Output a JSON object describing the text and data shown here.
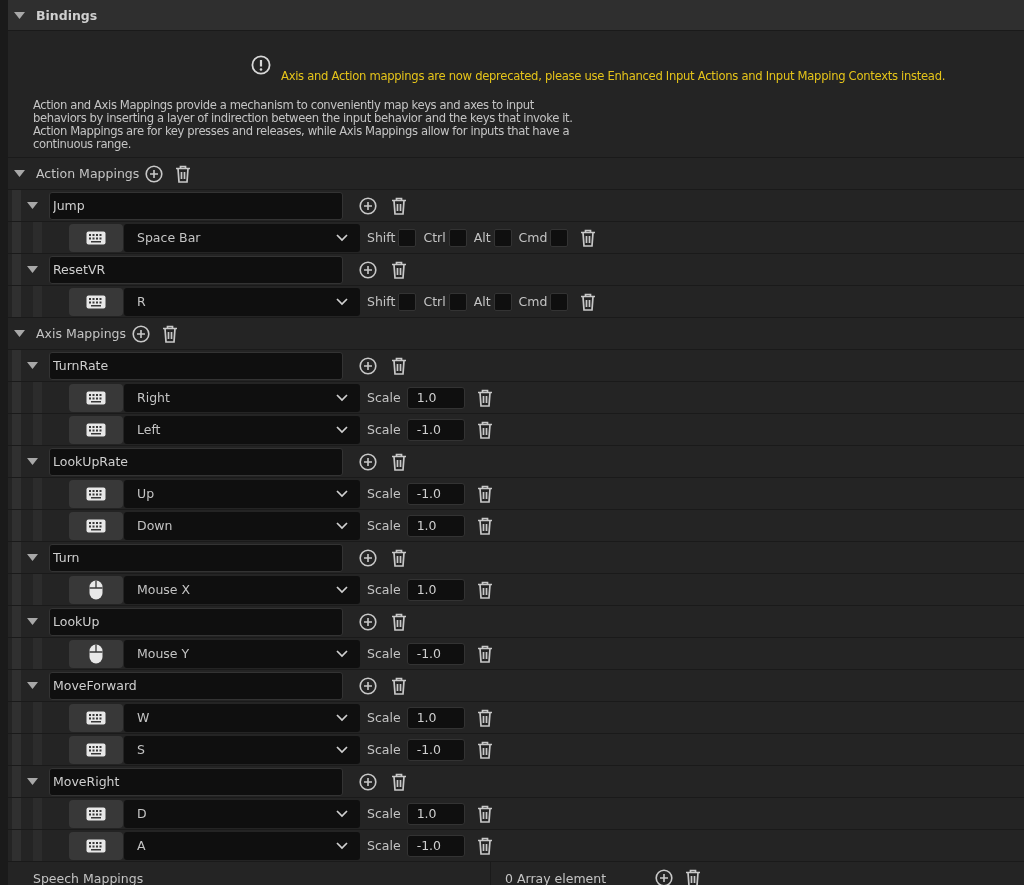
{
  "section": {
    "title": "Bindings",
    "expanded": true
  },
  "warning": "Axis and Action mappings are now deprecated, please use Enhanced Input Actions and Input Mapping Contexts instead.",
  "description": "Action and Axis Mappings provide a mechanism to conveniently map keys and axes to input behaviors by inserting a layer of indirection between the input behavior and the keys that invoke it. Action Mappings are for key presses and releases, while Axis Mappings allow for inputs that have a continuous range.",
  "action_mappings": {
    "label": "Action Mappings",
    "expanded": true,
    "items": [
      {
        "name": "Jump",
        "expanded": true,
        "keys": [
          {
            "kind": "keyboard",
            "key": "Space Bar",
            "modifiers": [
              {
                "label": "Shift",
                "checked": false
              },
              {
                "label": "Ctrl",
                "checked": false
              },
              {
                "label": "Alt",
                "checked": false
              },
              {
                "label": "Cmd",
                "checked": false
              }
            ]
          }
        ]
      },
      {
        "name": "ResetVR",
        "expanded": true,
        "keys": [
          {
            "kind": "keyboard",
            "key": "R",
            "modifiers": [
              {
                "label": "Shift",
                "checked": false
              },
              {
                "label": "Ctrl",
                "checked": false
              },
              {
                "label": "Alt",
                "checked": false
              },
              {
                "label": "Cmd",
                "checked": false
              }
            ]
          }
        ]
      }
    ]
  },
  "axis_mappings": {
    "label": "Axis Mappings",
    "expanded": true,
    "items": [
      {
        "name": "TurnRate",
        "expanded": true,
        "keys": [
          {
            "kind": "keyboard",
            "key": "Right",
            "scale_label": "Scale",
            "scale": "1.0"
          },
          {
            "kind": "keyboard",
            "key": "Left",
            "scale_label": "Scale",
            "scale": "-1.0"
          }
        ]
      },
      {
        "name": "LookUpRate",
        "expanded": true,
        "keys": [
          {
            "kind": "keyboard",
            "key": "Up",
            "scale_label": "Scale",
            "scale": "-1.0"
          },
          {
            "kind": "keyboard",
            "key": "Down",
            "scale_label": "Scale",
            "scale": "1.0"
          }
        ]
      },
      {
        "name": "Turn",
        "expanded": true,
        "keys": [
          {
            "kind": "mouse",
            "key": "Mouse X",
            "scale_label": "Scale",
            "scale": "1.0"
          }
        ]
      },
      {
        "name": "LookUp",
        "expanded": true,
        "keys": [
          {
            "kind": "mouse",
            "key": "Mouse Y",
            "scale_label": "Scale",
            "scale": "-1.0"
          }
        ]
      },
      {
        "name": "MoveForward",
        "expanded": true,
        "keys": [
          {
            "kind": "keyboard",
            "key": "W",
            "scale_label": "Scale",
            "scale": "1.0"
          },
          {
            "kind": "keyboard",
            "key": "S",
            "scale_label": "Scale",
            "scale": "-1.0"
          }
        ]
      },
      {
        "name": "MoveRight",
        "expanded": true,
        "keys": [
          {
            "kind": "keyboard",
            "key": "D",
            "scale_label": "Scale",
            "scale": "1.0"
          },
          {
            "kind": "keyboard",
            "key": "A",
            "scale_label": "Scale",
            "scale": "-1.0"
          }
        ]
      }
    ]
  },
  "speech_mappings": {
    "label": "Speech Mappings",
    "value": "0 Array element"
  }
}
